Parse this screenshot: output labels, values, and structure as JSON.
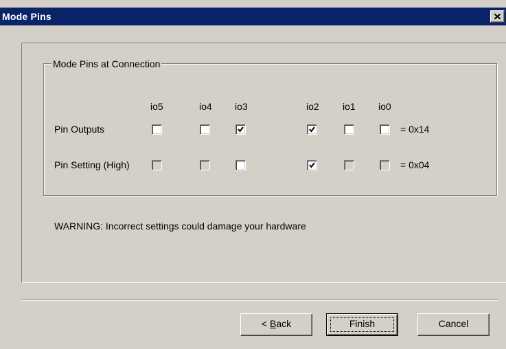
{
  "window": {
    "title": "Mode Pins",
    "close_icon": "close-x-icon"
  },
  "group": {
    "legend": "Mode Pins at Connection",
    "columns": [
      "io5",
      "io4",
      "io3",
      "io2",
      "io1",
      "io0"
    ],
    "rows": [
      {
        "label": "Pin Outputs",
        "checked": [
          false,
          false,
          true,
          true,
          false,
          false
        ],
        "disabled": [
          false,
          false,
          false,
          false,
          false,
          false
        ],
        "value": "= 0x14"
      },
      {
        "label": "Pin Setting (High)",
        "checked": [
          false,
          false,
          false,
          true,
          false,
          false
        ],
        "disabled": [
          true,
          true,
          false,
          false,
          true,
          true
        ],
        "value": "= 0x04"
      }
    ]
  },
  "warning": "WARNING: Incorrect settings could damage your hardware",
  "buttons": {
    "back_prefix": "< ",
    "back_mnemonic": "B",
    "back_rest": "ack",
    "finish": "Finish",
    "cancel": "Cancel"
  },
  "colors": {
    "titlebar": "#0a246a",
    "face": "#d4d0c8"
  }
}
